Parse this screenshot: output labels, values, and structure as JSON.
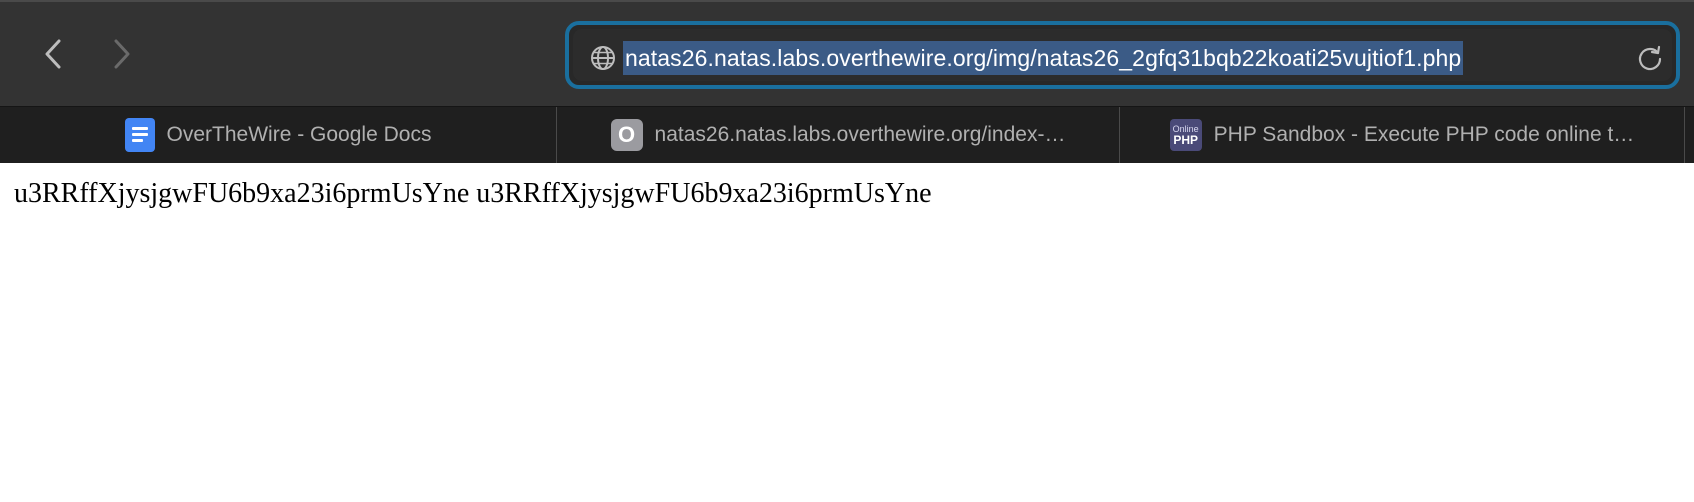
{
  "toolbar": {
    "back_icon": "chevron-left-icon",
    "forward_icon": "chevron-right-icon",
    "address": {
      "url": "natas26.natas.labs.overthewire.org/img/natas26_2gfq31bqb22koati25vujtiof1.php",
      "site_icon": "globe-icon",
      "reload_icon": "reload-icon"
    }
  },
  "tabs": [
    {
      "label": "OverTheWire - Google Docs",
      "icon": "google-docs-icon"
    },
    {
      "label": "natas26.natas.labs.overthewire.org/index-…",
      "icon": "letter-o-icon",
      "icon_text": "O"
    },
    {
      "label": "PHP Sandbox - Execute PHP code online t…",
      "icon": "online-php-icon",
      "icon_text_top": "Online",
      "icon_text_bottom": "PHP"
    }
  ],
  "page": {
    "body_text": "u3RRffXjysjgwFU6b9xa23i6prmUsYne u3RRffXjysjgwFU6b9xa23i6prmUsYne"
  },
  "colors": {
    "toolbar_bg": "#333333",
    "tabbar_bg": "#1f1f1f",
    "focus_ring": "#1a6f9e",
    "url_selection": "#3b5b86"
  }
}
